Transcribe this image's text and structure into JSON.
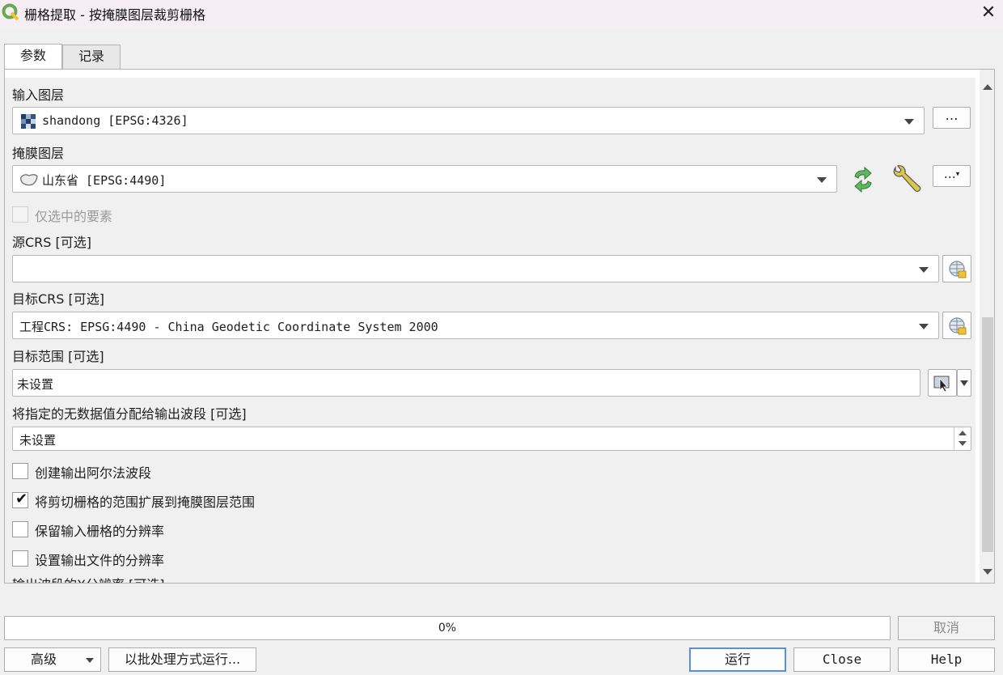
{
  "window": {
    "title": "栅格提取 - 按掩膜图层裁剪栅格",
    "app_icon": "qgis-icon",
    "close_glyph": "✕"
  },
  "tabs": [
    {
      "label": "参数",
      "active": true
    },
    {
      "label": "记录",
      "active": false
    }
  ],
  "params": {
    "input_layer": {
      "label": "输入图层",
      "value": "shandong [EPSG:4326]",
      "icon": "raster-layer-icon",
      "more": "…"
    },
    "mask_layer": {
      "label": "掩膜图层",
      "value": "山东省 [EPSG:4490]",
      "icon": "polygon-layer-icon",
      "more": "…"
    },
    "selected_only": {
      "label": "仅选中的要素",
      "checked": false,
      "enabled": false
    },
    "source_crs": {
      "label": "源CRS [可选]",
      "value": ""
    },
    "target_crs": {
      "label": "目标CRS [可选]",
      "value": "工程CRS: EPSG:4490 - China Geodetic Coordinate System 2000"
    },
    "target_extent": {
      "label": "目标范围 [可选]",
      "value": "未设置"
    },
    "nodata": {
      "label": "将指定的无数据值分配给输出波段 [可选]",
      "value": "未设置"
    },
    "checkboxes": [
      {
        "label": "创建输出阿尔法波段",
        "checked": false
      },
      {
        "label": "将剪切栅格的范围扩展到掩膜图层范围",
        "checked": true
      },
      {
        "label": "保留输入栅格的分辨率",
        "checked": false
      },
      {
        "label": "设置输出文件的分辨率",
        "checked": false
      }
    ],
    "cut_label": "输出波段的X分辨率 [可选]"
  },
  "footer": {
    "progress": "0%",
    "progress_fraction": 0.0,
    "cancel": "取消",
    "advanced": "高级",
    "batch": "以批处理方式运行...",
    "run": "运行",
    "close": "Close",
    "help": "Help"
  },
  "colors": {
    "accent_border": "#5a8fd0",
    "checkmark": "#111111"
  }
}
